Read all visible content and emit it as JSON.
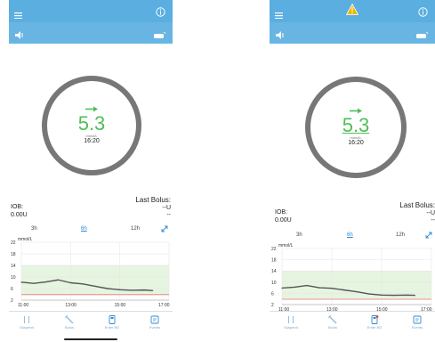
{
  "left": {
    "glucose": "5.3",
    "units": "mmol/L",
    "time": "16:20",
    "iob_label": "IOB:",
    "iob_value": "0.00U",
    "last_bolus_label": "Last Bolus:",
    "last_bolus_value": "--U",
    "last_bolus_time": "--",
    "ranges": [
      "3h",
      "6h",
      "12h"
    ],
    "selected_range": "6h",
    "chart": {
      "unit_label": "mmol/L",
      "y_ticks": [
        "22",
        "18",
        "14",
        "10",
        "6",
        "2"
      ],
      "x_ticks": [
        "11:00",
        "13:00",
        "15:00",
        "17:00"
      ]
    },
    "nav": [
      "Suspend",
      "Bolus",
      "Enter BG",
      "Events"
    ]
  },
  "right": {
    "glucose": "5.3",
    "units": "mmol/L",
    "time": "16:20",
    "iob_label": "IOB:",
    "iob_value": "0.00U",
    "last_bolus_label": "Last Bolus:",
    "last_bolus_value": "--U",
    "last_bolus_time": "--",
    "ranges": [
      "3h",
      "6h",
      "12h"
    ],
    "selected_range": "6h",
    "chart": {
      "unit_label": "mmol/L",
      "y_ticks": [
        "22",
        "18",
        "14",
        "10",
        "6",
        "2"
      ],
      "x_ticks": [
        "11:00",
        "13:00",
        "15:00",
        "17:00"
      ]
    },
    "nav": [
      "Suspend",
      "Bolus",
      "Enter BG",
      "Events"
    ]
  },
  "colors": {
    "header": "#5aaee0",
    "glucose": "#4fbf58",
    "target_range": "#e6f5e0",
    "low_line": "#e57373",
    "alert": "#f0b400"
  },
  "chart_data": [
    {
      "type": "line",
      "title": "",
      "ylabel": "mmol/L",
      "ylim": [
        2,
        22
      ],
      "x": [
        "11:00",
        "11:30",
        "12:00",
        "12:30",
        "13:00",
        "13:30",
        "14:00",
        "14:30",
        "15:00",
        "15:30",
        "16:00",
        "16:20"
      ],
      "series": [
        {
          "values": [
            8.2,
            7.8,
            8.3,
            9.0,
            8.0,
            7.6,
            6.8,
            6.0,
            5.6,
            5.4,
            5.5,
            5.3
          ]
        }
      ],
      "target_range": [
        4,
        14
      ],
      "low_threshold": 3.9
    },
    {
      "type": "line",
      "title": "",
      "ylabel": "mmol/L",
      "ylim": [
        2,
        22
      ],
      "x": [
        "11:00",
        "11:30",
        "12:00",
        "12:30",
        "13:00",
        "13:30",
        "14:00",
        "14:30",
        "15:00",
        "15:30",
        "16:00",
        "16:20"
      ],
      "series": [
        {
          "values": [
            7.9,
            8.2,
            8.8,
            8.0,
            7.8,
            7.2,
            6.6,
            5.8,
            5.4,
            5.3,
            5.4,
            5.3
          ]
        }
      ],
      "target_range": [
        4,
        14
      ],
      "low_threshold": 3.9
    }
  ]
}
